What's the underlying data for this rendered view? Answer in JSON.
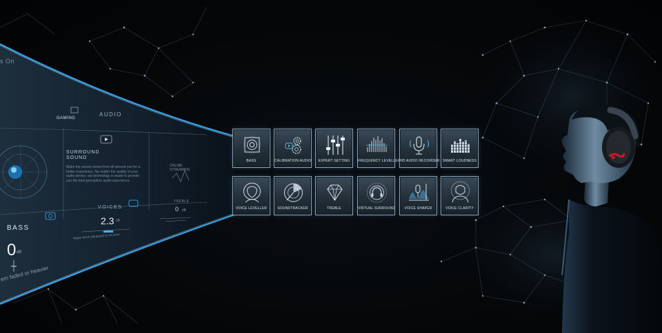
{
  "panel": {
    "status_partial": "s On",
    "mode_label": "GAMING",
    "audio_label": "AUDIO",
    "surround_title": "SURROUND SOUND",
    "surround_desc": "Make the sound comes from all around you for a better experience. No matter the quality of your audio device, our technology is made to provide you the best perception audio experience.",
    "voices_label": "VOICES",
    "voices_value": "2.3",
    "voices_unit": "dB",
    "voices_hint": "Make them pleasant to receive",
    "bass_label": "BASS",
    "bass_value": "0",
    "bass_unit": "dB",
    "bass_hint": "em faded or heavier",
    "online_label": "ONLINE STREAMING",
    "treble_label": "TREBLE",
    "treble_value": "0",
    "treble_unit": "dB"
  },
  "features": [
    {
      "label": "BASS",
      "icon": "speaker-icon"
    },
    {
      "label": "CALIBRATION AUDIO",
      "icon": "gears-icon"
    },
    {
      "label": "EXPERT SETTING",
      "icon": "sliders-icon"
    },
    {
      "label": "FREQUENCY LEVELLER",
      "icon": "frequency-bars-icon"
    },
    {
      "label": "HD AUDIO RECORDER",
      "icon": "microphone-icon"
    },
    {
      "label": "SMART LOUDNESS",
      "icon": "equalizer-icon"
    },
    {
      "label": "VOICE LEVELLER",
      "icon": "face-icon"
    },
    {
      "label": "SOUNDTRACKER",
      "icon": "radar-icon"
    },
    {
      "label": "TREBLE",
      "icon": "diamond-icon"
    },
    {
      "label": "VIRTUAL SURROUND",
      "icon": "headphones-icon"
    },
    {
      "label": "VOICE SHAPER",
      "icon": "mic-wave-icon"
    },
    {
      "label": "VOICE CLARITY",
      "icon": "person-icon"
    }
  ],
  "colors": {
    "background": "#040608",
    "tile_border": "#8aa7bf",
    "accent": "#3ab4ff",
    "logo_red": "#d3162c"
  }
}
